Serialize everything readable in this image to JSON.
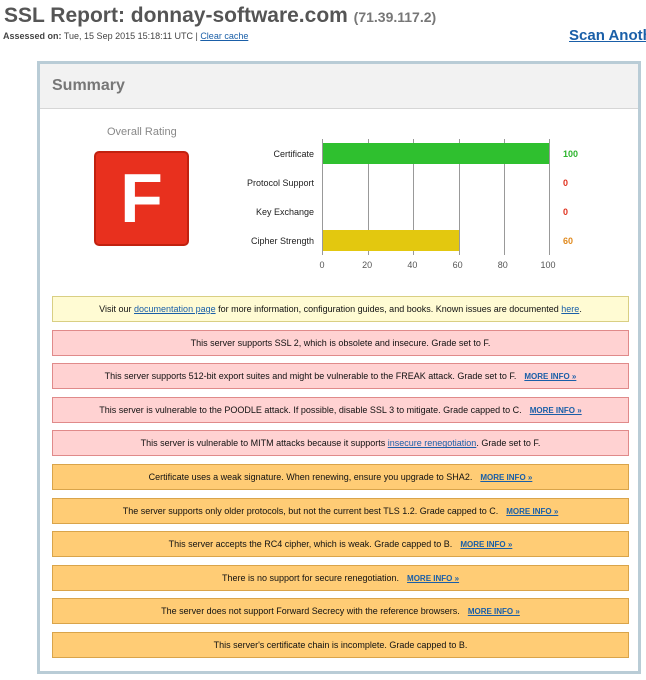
{
  "header": {
    "title": "SSL Report: donnay-software.com",
    "ip": "(71.39.117.2)",
    "assessed_label": "Assessed on:",
    "assessed_date": "Tue, 15 Sep 2015 15:18:11 UTC",
    "clear_cache": "Clear cache",
    "scan_another": "Scan Anoth"
  },
  "summary": {
    "title": "Summary",
    "rating_label": "Overall Rating",
    "grade": "F",
    "grade_color": "#e8301e"
  },
  "chart_data": {
    "type": "bar",
    "orientation": "horizontal",
    "categories": [
      "Certificate",
      "Protocol Support",
      "Key Exchange",
      "Cipher Strength"
    ],
    "values": [
      100,
      0,
      0,
      60
    ],
    "value_labels": [
      "100",
      "0",
      "0",
      "60"
    ],
    "value_colors": [
      "#2db52d",
      "#e0321e",
      "#e0321e",
      "#e08a1e"
    ],
    "bar_colors": [
      "#2fc02f",
      "#2fc02f",
      "#2fc02f",
      "#e3c80f"
    ],
    "xlim": [
      0,
      100
    ],
    "xticks": [
      "0",
      "20",
      "40",
      "60",
      "80",
      "100"
    ],
    "grid": true
  },
  "messages": [
    {
      "type": "info",
      "pre": "Visit our ",
      "link1": "documentation page",
      "mid": " for more information, configuration guides, and books. Known issues are documented ",
      "link2": "here",
      "post": "."
    },
    {
      "type": "error",
      "text": "This server supports SSL 2, which is obsolete and insecure. Grade set to F."
    },
    {
      "type": "error",
      "text": "This server supports 512-bit export suites and might be vulnerable to the FREAK attack. Grade set to F.",
      "more": "MORE INFO »"
    },
    {
      "type": "error",
      "text": "This server is vulnerable to the POODLE attack. If possible, disable SSL 3 to mitigate. Grade capped to C.",
      "more": "MORE INFO »"
    },
    {
      "type": "error",
      "pre": "This server is vulnerable to MITM attacks because it supports ",
      "link": "insecure renegotiation",
      "post": ". Grade set to F."
    },
    {
      "type": "warning",
      "text": "Certificate uses a weak signature. When renewing, ensure you upgrade to SHA2.",
      "more": "MORE INFO »"
    },
    {
      "type": "warning",
      "text": "The server supports only older protocols, but not the current best TLS 1.2. Grade capped to C.",
      "more": "MORE INFO »"
    },
    {
      "type": "warning",
      "text": "This server accepts the RC4 cipher, which is weak. Grade capped to B.",
      "more": "MORE INFO »"
    },
    {
      "type": "warning",
      "text": "There is no support for secure renegotiation.",
      "more": "MORE INFO »"
    },
    {
      "type": "warning",
      "text": "The server does not support Forward Secrecy with the reference browsers.",
      "more": "MORE INFO »"
    },
    {
      "type": "warning",
      "text": "This server's certificate chain is incomplete. Grade capped to B."
    }
  ]
}
